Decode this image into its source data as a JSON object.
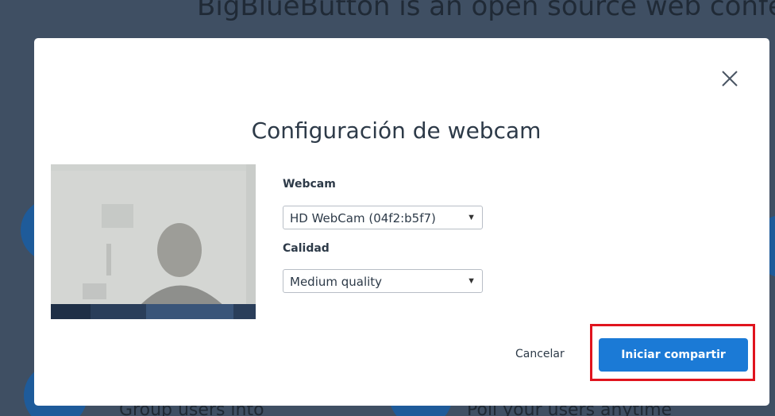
{
  "background": {
    "heading": "BigBlueButton is an open source web conferencing",
    "feature_left": "Group users into",
    "feature_right": "Poll your users anytime"
  },
  "modal": {
    "title": "Configuración de webcam",
    "close_icon": "close-icon",
    "webcam_label": "Webcam",
    "webcam_selected": "HD WebCam (04f2:b5f7)",
    "quality_label": "Calidad",
    "quality_selected": "Medium quality",
    "cancel_label": "Cancelar",
    "start_label": "Iniciar compartir"
  },
  "colors": {
    "backdrop": "#3f4f63",
    "primary": "#1b7ad6",
    "highlight": "#e0141e"
  }
}
